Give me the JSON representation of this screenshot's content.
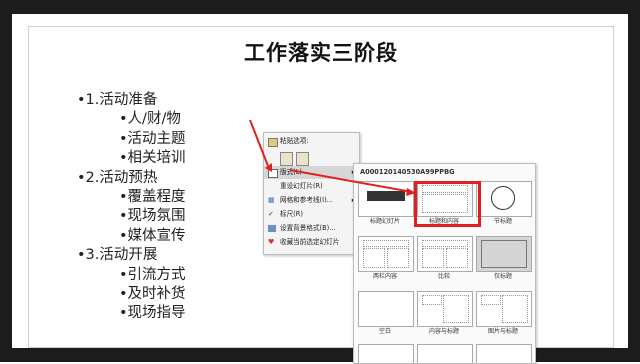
{
  "slide": {
    "title": "工作落实三阶段",
    "bullets": [
      {
        "level": 1,
        "text": "•1.活动准备"
      },
      {
        "level": 2,
        "text": "•人/财/物"
      },
      {
        "level": 2,
        "text": "•活动主题"
      },
      {
        "level": 2,
        "text": "•相关培训"
      },
      {
        "level": 1,
        "text": "•2.活动预热"
      },
      {
        "level": 2,
        "text": "•覆盖程度"
      },
      {
        "level": 2,
        "text": "•现场氛围"
      },
      {
        "level": 2,
        "text": "•媒体宣传"
      },
      {
        "level": 1,
        "text": "•3.活动开展"
      },
      {
        "level": 2,
        "text": "•引流方式"
      },
      {
        "level": 2,
        "text": "•及时补货"
      },
      {
        "level": 2,
        "text": "•现场指导"
      }
    ]
  },
  "context_menu": {
    "paste_options": "粘贴选项:",
    "layout": "版式(L)",
    "reset": "重设幻灯片(R)",
    "grid": "网格和参考线(I)...",
    "ruler": "标尺(R)",
    "background": "设置背景格式(B)...",
    "favorite": "收藏当前选定幻灯片"
  },
  "gallery": {
    "header": "A000120140530A99PPBG",
    "layouts": [
      {
        "label": "标题幻灯片"
      },
      {
        "label": "标题和内容"
      },
      {
        "label": "节标题"
      },
      {
        "label": "两栏内容"
      },
      {
        "label": "比较"
      },
      {
        "label": "仅标题"
      },
      {
        "label": "空白"
      },
      {
        "label": "内容与标题"
      },
      {
        "label": "图片与标题"
      }
    ],
    "selected": "仅标题",
    "highlighted": "标题和内容"
  },
  "colors": {
    "highlight": "#e02020",
    "frame": "#1c1c1c"
  }
}
